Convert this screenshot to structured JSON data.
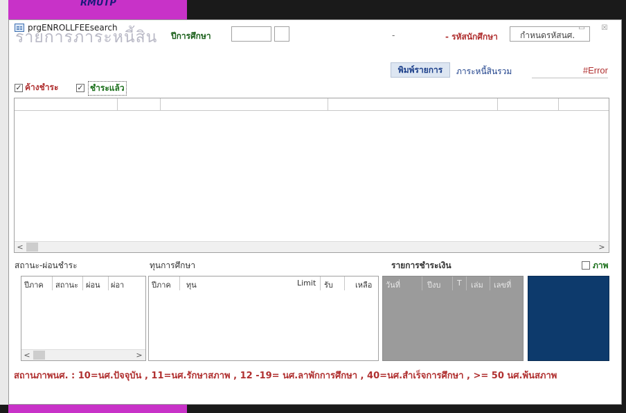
{
  "background": {
    "brand": "RMUTP"
  },
  "window": {
    "title": "prgENROLLFEEsearch",
    "minimize_glyph": "▭",
    "close_glyph": "☒"
  },
  "header": {
    "title": "รายการภาระหนี้สิน",
    "year_label": "ปีการศึกษา",
    "year_value": "",
    "term_value": "",
    "dash1": "-",
    "student_label": "- รหัสนักศึกษา",
    "student_value": "กำหนดรหัสนศ."
  },
  "filters": {
    "outstanding": {
      "label": "ค้างชำระ",
      "checked": true,
      "color": "#b03030"
    },
    "paid": {
      "label": "ชำระแล้ว",
      "checked": true,
      "color": "#1a6f1a"
    },
    "print_button": "พิมพ์รายการ",
    "total_label": "ภาระหนี้สินรวม",
    "total_value": "#Error"
  },
  "main_grid": {
    "rows": []
  },
  "status_panel": {
    "title": "สถานะ-ผ่อนชำระ",
    "columns": [
      "ปีภาค",
      "สถานะ",
      "ผ่อน",
      "ผ่อา"
    ]
  },
  "scholarship_panel": {
    "title": "ทุนการศึกษา",
    "columns": [
      "ปีภาค",
      "ทุน",
      "Limit",
      "รับ",
      "เหลือ"
    ]
  },
  "payment_panel": {
    "title": "รายการชำระเงิน",
    "columns": [
      "วันที่",
      "ปีงบ",
      "T",
      "เล่ม",
      "เลขที่"
    ]
  },
  "photo": {
    "label": "ภาพ",
    "checked": false,
    "color": "#0d3a6c"
  },
  "scroll": {
    "left": "<",
    "right": ">"
  },
  "note": "สถานภาพนศ. :  10=นศ.ปัจจุบัน , 11=นศ.รักษาสภาพ , 12 -19= นศ.ลาพักการศึกษา , 40=นศ.สำเร็จการศึกษา , >= 50 นศ.พ้นสภาพ"
}
